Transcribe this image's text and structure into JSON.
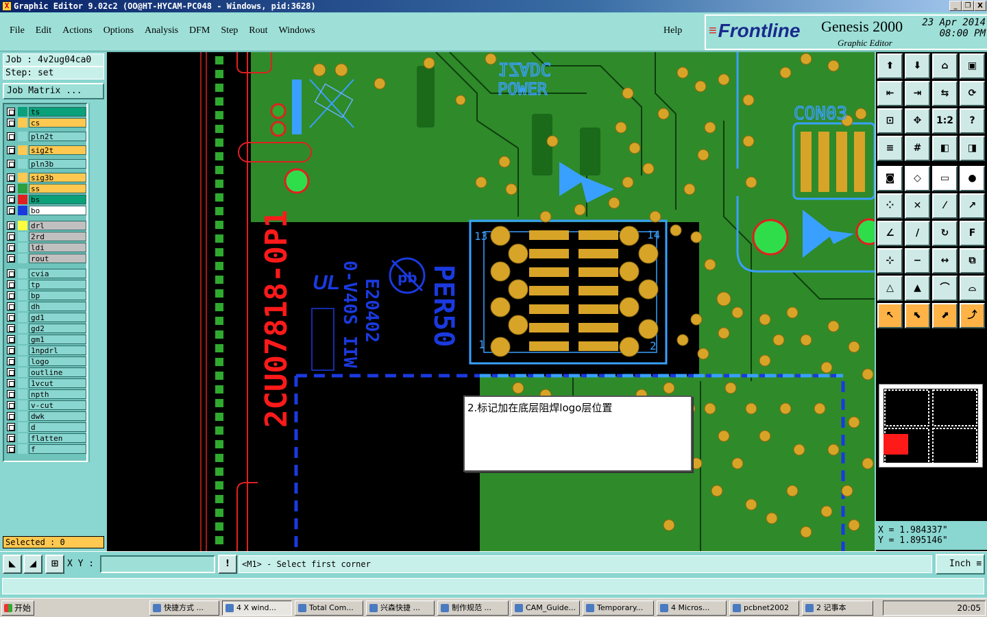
{
  "window": {
    "title": "Graphic Editor 9.02c2 (OO@HT-HYCAM-PC048 - Windows, pid:3628)",
    "min_label": "_",
    "restore_label": "❐",
    "close_label": "X"
  },
  "menu": {
    "items": [
      "File",
      "Edit",
      "Actions",
      "Options",
      "Analysis",
      "DFM",
      "Step",
      "Rout",
      "Windows"
    ],
    "help": "Help"
  },
  "brand": {
    "logo": "Frontline",
    "product": "Genesis 2000",
    "subtitle": "Graphic Editor",
    "date": "23 Apr 2014",
    "time": "08:00 PM"
  },
  "job": {
    "job_label": "Job : 4v2ug04ca0",
    "step_label": "Step: set",
    "matrix_button": "Job Matrix ..."
  },
  "layers": [
    {
      "name": "ts",
      "color": "#0aa07a",
      "swatch": "#0aa07a"
    },
    {
      "name": "cs",
      "color": "#ffc850",
      "swatch": "#ffc850"
    },
    {
      "name": "pln2t",
      "color": "#8ad6d0",
      "swatch": "#8ad6d0"
    },
    {
      "name": "sig2t",
      "color": "#ffc850",
      "swatch": "#ffc850"
    },
    {
      "name": "pln3b",
      "color": "#8ad6d0",
      "swatch": "#8ad6d0"
    },
    {
      "name": "sig3b",
      "color": "#ffc850",
      "swatch": "#ffc850"
    },
    {
      "name": "ss",
      "color": "#ffc850",
      "swatch": "#2aa040"
    },
    {
      "name": "bs",
      "color": "#0aa07a",
      "swatch": "#e02020"
    },
    {
      "name": "bo",
      "color": "#ffffff",
      "swatch": "#1a3ae0"
    },
    {
      "name": "drl",
      "color": "#c0c0c0",
      "swatch": "#ffff40"
    },
    {
      "name": "2rd",
      "color": "#c0c0c0",
      "swatch": "#8ad6d0"
    },
    {
      "name": "ldi",
      "color": "#c0c0c0",
      "swatch": "#8ad6d0"
    },
    {
      "name": "rout",
      "color": "#c0c0c0",
      "swatch": "#8ad6d0"
    },
    {
      "name": "cvia",
      "color": "#8ad6d0",
      "swatch": "#8ad6d0"
    },
    {
      "name": "tp",
      "color": "#8ad6d0",
      "swatch": "#8ad6d0"
    },
    {
      "name": "bp",
      "color": "#8ad6d0",
      "swatch": "#8ad6d0"
    },
    {
      "name": "dh",
      "color": "#8ad6d0",
      "swatch": "#8ad6d0"
    },
    {
      "name": "gd1",
      "color": "#8ad6d0",
      "swatch": "#8ad6d0"
    },
    {
      "name": "gd2",
      "color": "#8ad6d0",
      "swatch": "#8ad6d0"
    },
    {
      "name": "gm1",
      "color": "#8ad6d0",
      "swatch": "#8ad6d0"
    },
    {
      "name": "1npdrl",
      "color": "#8ad6d0",
      "swatch": "#8ad6d0"
    },
    {
      "name": "logo",
      "color": "#8ad6d0",
      "swatch": "#8ad6d0"
    },
    {
      "name": "outline",
      "color": "#8ad6d0",
      "swatch": "#8ad6d0"
    },
    {
      "name": "1vcut",
      "color": "#8ad6d0",
      "swatch": "#8ad6d0"
    },
    {
      "name": "npth",
      "color": "#8ad6d0",
      "swatch": "#8ad6d0"
    },
    {
      "name": "v-cut",
      "color": "#8ad6d0",
      "swatch": "#8ad6d0"
    },
    {
      "name": "dwk",
      "color": "#8ad6d0",
      "swatch": "#8ad6d0"
    },
    {
      "name": "d",
      "color": "#8ad6d0",
      "swatch": "#8ad6d0"
    },
    {
      "name": "flatten",
      "color": "#8ad6d0",
      "swatch": "#8ad6d0"
    },
    {
      "name": "f",
      "color": "#8ad6d0",
      "swatch": "#8ad6d0"
    }
  ],
  "selected_label": "Selected : 0",
  "board": {
    "text_red": "2CU07818-0P1",
    "text_blue_1": "PER50",
    "text_blue_2": "E20402",
    "text_blue_3": "0-V40S IIW",
    "text_ul": "UL",
    "text_pb": "pb",
    "silk_1": "1ZADC",
    "silk_2": "POWER",
    "silk_3": "CON03",
    "pin_13": "13",
    "pin_14": "14",
    "pin_1": "1",
    "pin_2": "2"
  },
  "note": "2.标记加在底层阻焊logo层位置",
  "coords": {
    "x": "X = 1.984337\"",
    "y": "Y = 1.895146\""
  },
  "status": {
    "xy_label": "X Y :",
    "xy_value": "",
    "bang": "!",
    "prompt": "<M1> - Select first corner",
    "unit": "Inch"
  },
  "taskbar": {
    "start": "开始",
    "items": [
      "快捷方式 ...",
      "4 X wind...",
      "Total Com...",
      "兴森快捷 ...",
      "制作规范 ...",
      "CAM_Guide...",
      "Temporary...",
      "4 Micros...",
      "pcbnet2002",
      "2 记事本"
    ],
    "clock": "20:05"
  }
}
